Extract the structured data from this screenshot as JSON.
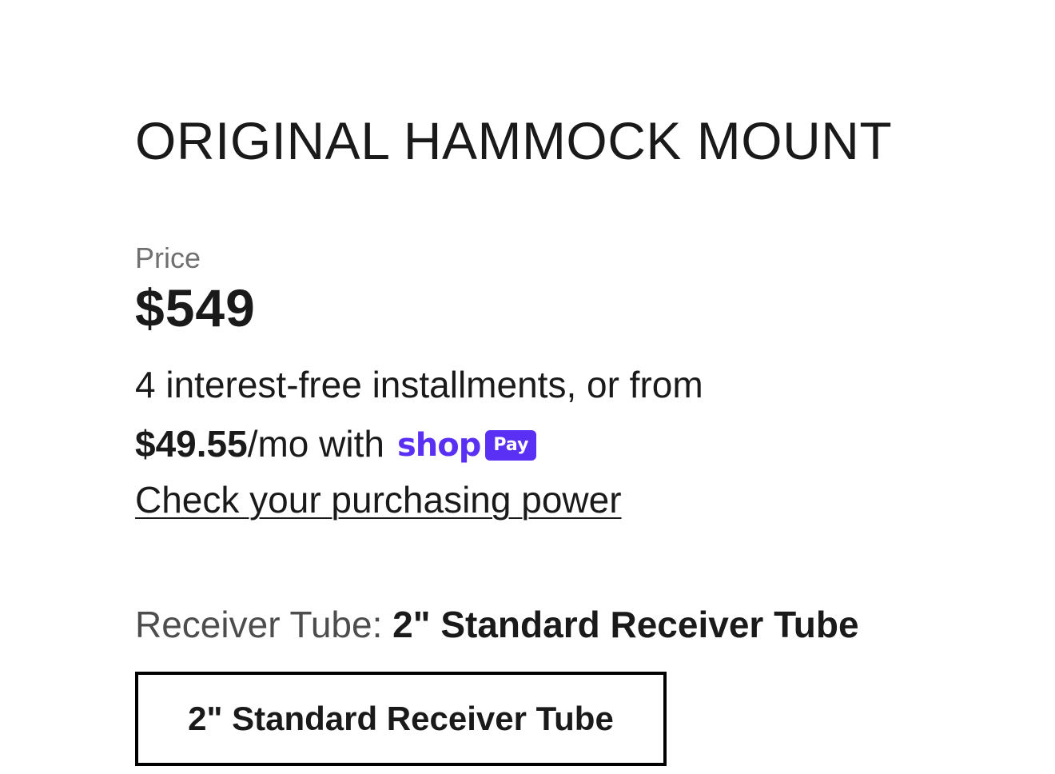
{
  "product": {
    "title": "ORIGINAL HAMMOCK MOUNT",
    "price_label": "Price",
    "price": "$549",
    "installments_text": "4 interest-free installments, or from",
    "monthly_amount": "$49.55",
    "monthly_suffix": "/mo with",
    "shoppay": {
      "shop_word": "shop",
      "pay_badge": "Pay",
      "brand_color": "#5a31f4"
    },
    "check_link": "Check your purchasing power",
    "variant": {
      "label": "Receiver Tube: ",
      "selected_value": "2\" Standard Receiver Tube",
      "options": [
        "2\" Standard Receiver Tube"
      ]
    }
  }
}
